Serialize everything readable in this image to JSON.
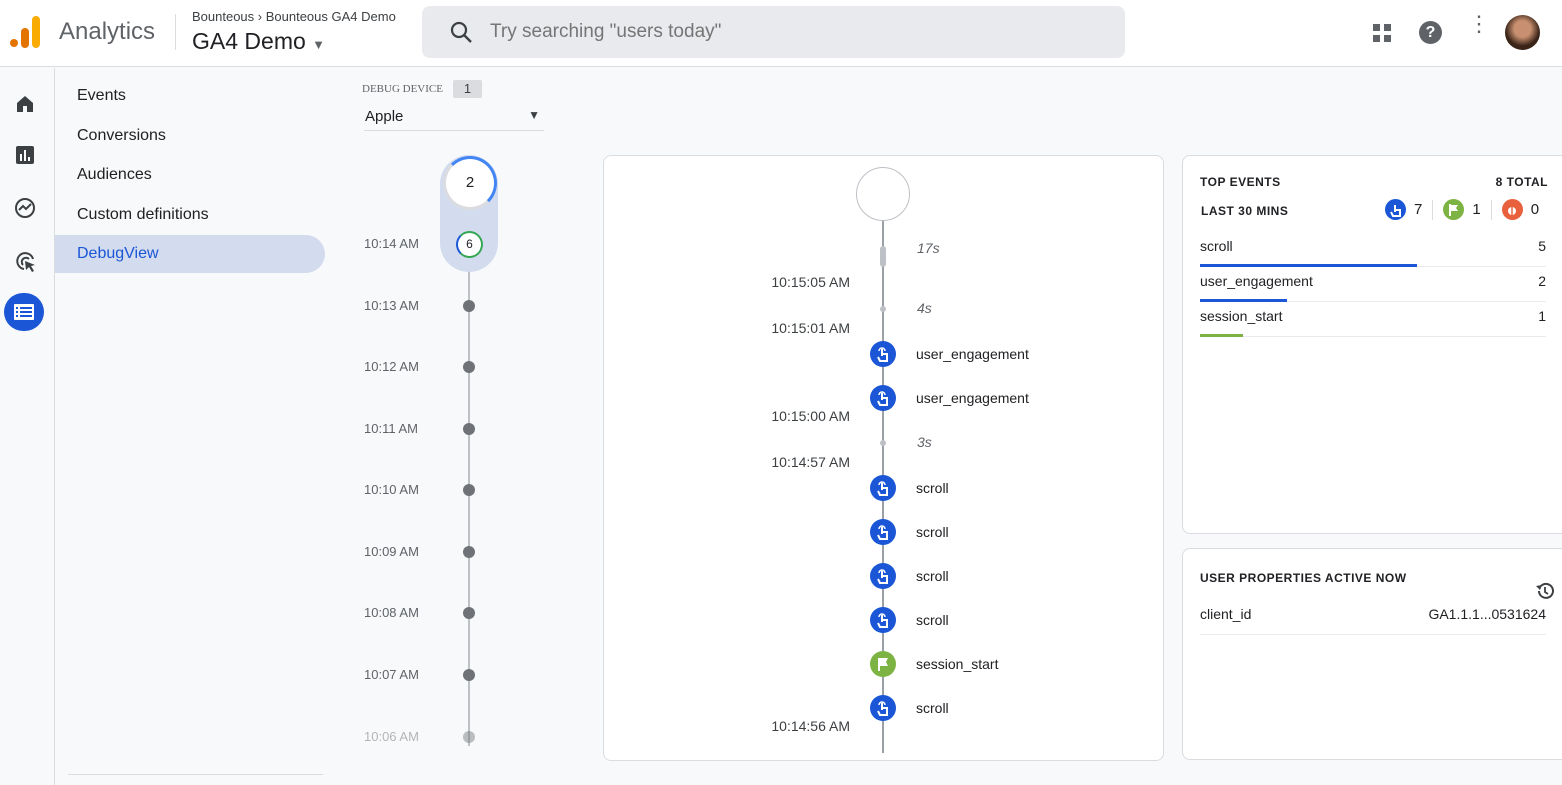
{
  "header": {
    "app_name": "Analytics",
    "breadcrumb": [
      "Bounteous",
      "Bounteous GA4 Demo"
    ],
    "property": "GA4 Demo",
    "search_placeholder": "Try searching \"users today\""
  },
  "nav": {
    "items": [
      {
        "label": "Events"
      },
      {
        "label": "Conversions"
      },
      {
        "label": "Audiences"
      },
      {
        "label": "Custom definitions"
      },
      {
        "label": "DebugView",
        "active": true
      }
    ]
  },
  "rail": {
    "icons": [
      "home-icon",
      "reports-icon",
      "explore-icon",
      "advertising-icon",
      "configure-icon"
    ]
  },
  "debug_device": {
    "label": "DEBUG DEVICE",
    "count": "1",
    "selected": "Apple"
  },
  "minutes": {
    "current_count": "2",
    "first_count": "6",
    "times": [
      "10:14 AM",
      "10:13 AM",
      "10:12 AM",
      "10:11 AM",
      "10:10 AM",
      "10:09 AM",
      "10:08 AM",
      "10:07 AM",
      "10:06 AM"
    ]
  },
  "stream": {
    "gaps": [
      "17s",
      "4s",
      "3s"
    ],
    "times": [
      "10:15:05 AM",
      "10:15:01 AM",
      "10:15:00 AM",
      "10:14:57 AM",
      "10:14:56 AM"
    ],
    "events": [
      {
        "name": "user_engagement",
        "type": "event"
      },
      {
        "name": "user_engagement",
        "type": "event"
      },
      {
        "name": "scroll",
        "type": "event"
      },
      {
        "name": "scroll",
        "type": "event"
      },
      {
        "name": "scroll",
        "type": "event"
      },
      {
        "name": "scroll",
        "type": "event"
      },
      {
        "name": "session_start",
        "type": "conversion"
      },
      {
        "name": "scroll",
        "type": "event"
      }
    ]
  },
  "top_events": {
    "title": "TOP EVENTS",
    "total": "8 TOTAL",
    "period": "LAST 30 MINS",
    "counts": {
      "events": "7",
      "conversions": "1",
      "errors": "0"
    },
    "rows": [
      {
        "name": "scroll",
        "count": "5",
        "fraction": 1.0,
        "color": "#1a56d6"
      },
      {
        "name": "user_engagement",
        "count": "2",
        "fraction": 0.4,
        "color": "#1a56d6"
      },
      {
        "name": "session_start",
        "count": "1",
        "fraction": 0.2,
        "color": "#7cb342"
      }
    ]
  },
  "user_properties": {
    "title": "USER PROPERTIES ACTIVE NOW",
    "rows": [
      {
        "name": "client_id",
        "value": "GA1.1.1...0531624"
      }
    ]
  },
  "colors": {
    "accent": "#1a56d6",
    "conversion": "#7cb342",
    "error": "#e8603c"
  }
}
